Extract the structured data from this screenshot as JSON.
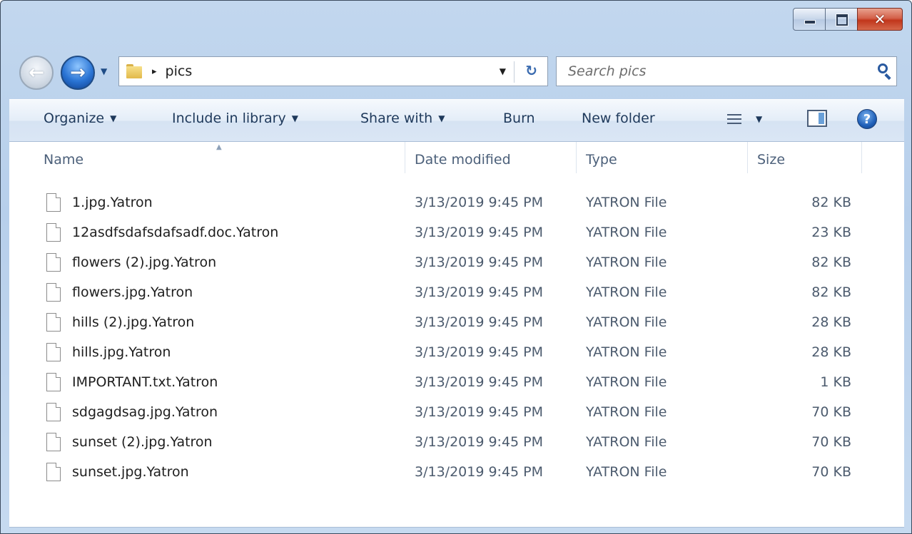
{
  "window": {
    "caption_buttons": {
      "minimize_icon": "minimize-icon",
      "maximize_icon": "maximize-icon",
      "close_glyph": "✕"
    }
  },
  "navigation": {
    "address": {
      "crumb_arrow": "▸",
      "path": "pics",
      "dropdown_glyph": "▼",
      "refresh_glyph": "↻"
    },
    "search": {
      "placeholder": "Search pics"
    }
  },
  "toolbar": {
    "organize": "Organize",
    "include_in_library": "Include in library",
    "share_with": "Share with",
    "burn": "Burn",
    "new_folder": "New folder",
    "caret": "▼",
    "help_glyph": "?"
  },
  "file_list": {
    "columns": [
      "Name",
      "Date modified",
      "Type",
      "Size"
    ],
    "rows": [
      {
        "name": "1.jpg.Yatron",
        "date": "3/13/2019 9:45 PM",
        "type": "YATRON File",
        "size": "82 KB"
      },
      {
        "name": "12asdfsdafsdafsadf.doc.Yatron",
        "date": "3/13/2019 9:45 PM",
        "type": "YATRON File",
        "size": "23 KB"
      },
      {
        "name": "flowers (2).jpg.Yatron",
        "date": "3/13/2019 9:45 PM",
        "type": "YATRON File",
        "size": "82 KB"
      },
      {
        "name": "flowers.jpg.Yatron",
        "date": "3/13/2019 9:45 PM",
        "type": "YATRON File",
        "size": "82 KB"
      },
      {
        "name": "hills (2).jpg.Yatron",
        "date": "3/13/2019 9:45 PM",
        "type": "YATRON File",
        "size": "28 KB"
      },
      {
        "name": "hills.jpg.Yatron",
        "date": "3/13/2019 9:45 PM",
        "type": "YATRON File",
        "size": "28 KB"
      },
      {
        "name": "IMPORTANT.txt.Yatron",
        "date": "3/13/2019 9:45 PM",
        "type": "YATRON File",
        "size": "1 KB"
      },
      {
        "name": "sdgagdsag.jpg.Yatron",
        "date": "3/13/2019 9:45 PM",
        "type": "YATRON File",
        "size": "70 KB"
      },
      {
        "name": "sunset (2).jpg.Yatron",
        "date": "3/13/2019 9:45 PM",
        "type": "YATRON File",
        "size": "70 KB"
      },
      {
        "name": "sunset.jpg.Yatron",
        "date": "3/13/2019 9:45 PM",
        "type": "YATRON File",
        "size": "70 KB"
      }
    ]
  },
  "colors": {
    "window_frame": "#b7cfeb",
    "close_button": "#c1361b",
    "text_primary": "#1e395b"
  }
}
